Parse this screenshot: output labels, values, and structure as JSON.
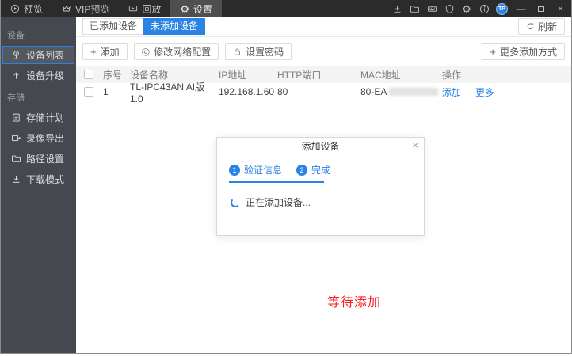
{
  "titlebar": {
    "tabs": [
      {
        "label": "预览"
      },
      {
        "label": "VIP预览"
      },
      {
        "label": "回放"
      },
      {
        "label": "设置"
      }
    ],
    "gear_glyph": "⚙",
    "logo_text": "TP",
    "controls": {
      "minimize": "—",
      "close": "×"
    }
  },
  "sidebar": {
    "sections": [
      {
        "title": "设备",
        "items": [
          {
            "label": "设备列表"
          },
          {
            "label": "设备升级"
          }
        ]
      },
      {
        "title": "存储",
        "items": [
          {
            "label": "存储计划"
          },
          {
            "label": "录像导出"
          },
          {
            "label": "路径设置"
          },
          {
            "label": "下载模式"
          }
        ]
      }
    ]
  },
  "main": {
    "tabs": [
      {
        "label": "已添加设备"
      },
      {
        "label": "未添加设备"
      }
    ],
    "refresh_label": "刷新",
    "toolbar": {
      "add_label": "添加",
      "add_plus": "+",
      "modify_network_label": "修改网络配置",
      "modify_network_glyph": "◎",
      "set_password_label": "设置密码",
      "more_methods_label": "更多添加方式",
      "more_plus": "+"
    },
    "table": {
      "headers": {
        "index": "序号",
        "name": "设备名称",
        "ip": "IP地址",
        "port": "HTTP端口",
        "mac": "MAC地址",
        "actions": "操作"
      },
      "rows": [
        {
          "index": "1",
          "name": "TL-IPC43AN AI版 1.0",
          "ip": "192.168.1.60",
          "port": "80",
          "mac_prefix": "80-EA",
          "mac_redacted": true,
          "action_add": "添加",
          "action_more": "更多"
        }
      ]
    },
    "status_text": "等待添加"
  },
  "dialog": {
    "title": "添加设备",
    "close": "×",
    "steps": [
      {
        "num": "1",
        "label": "验证信息"
      },
      {
        "num": "2",
        "label": "完成"
      }
    ],
    "loading_text": "正在添加设备..."
  },
  "icons": {
    "titlebar_left": [
      "play-circle-icon",
      "crown-icon",
      "playback-icon",
      "gear-icon"
    ],
    "titlebar_right": [
      "download-icon",
      "folder-icon",
      "device-keyboard-icon",
      "shield-icon",
      "gear-icon",
      "info-icon",
      "tp-logo"
    ],
    "sidebar": [
      "camera-icon",
      "upgrade-arrow-icon",
      "storage-plan-icon",
      "video-export-icon",
      "folder-path-icon",
      "download-mode-icon"
    ],
    "toolbar": [
      "plus-icon",
      "network-config-icon",
      "lock-icon",
      "refresh-icon",
      "plus-icon"
    ],
    "dialog": [
      "loading-spinner",
      "close-icon"
    ]
  },
  "colors": {
    "accent_blue": "#2a82e4",
    "active_tab_blue": "#2b83e3",
    "titlebar_bg": "#2b2b2b",
    "sidebar_bg": "#45484e",
    "status_red": "#fb1d1d",
    "table_header_bg": "#f4f4f4"
  }
}
